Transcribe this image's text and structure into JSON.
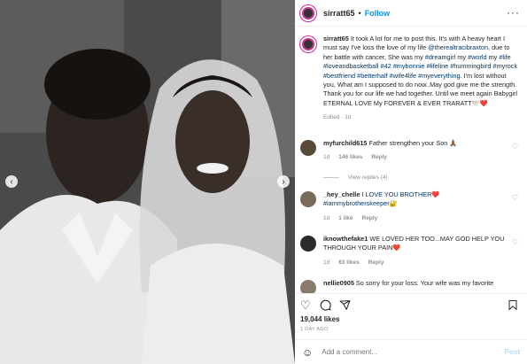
{
  "post": {
    "username": "sirratt65",
    "follow_label": "Follow",
    "more_icon": "more-horizontal-icon"
  },
  "caption": {
    "username": "sirratt65",
    "segments": [
      {
        "text": " It took A lot for me to post this. It's with A heavy heart I must say I've loss the love of my life ",
        "link": false
      },
      {
        "text": "@therealtracibraxton",
        "link": true
      },
      {
        "text": ", due to her battle with cancer, She was my ",
        "link": false
      },
      {
        "text": "#dreamgirl",
        "link": true
      },
      {
        "text": " my ",
        "link": false
      },
      {
        "text": "#world",
        "link": true
      },
      {
        "text": " my ",
        "link": false
      },
      {
        "text": "#life",
        "link": true
      },
      {
        "text": " ",
        "link": false
      },
      {
        "text": "#loveandbasketball",
        "link": true
      },
      {
        "text": " ",
        "link": false
      },
      {
        "text": "#42",
        "link": true
      },
      {
        "text": " ",
        "link": false
      },
      {
        "text": "#mybonnie",
        "link": true
      },
      {
        "text": " ",
        "link": false
      },
      {
        "text": "#lifeline",
        "link": true
      },
      {
        "text": " ",
        "link": false
      },
      {
        "text": "#hummingbird",
        "link": true
      },
      {
        "text": " ",
        "link": false
      },
      {
        "text": "#myrock",
        "link": true
      },
      {
        "text": " ",
        "link": false
      },
      {
        "text": "#bestfriend",
        "link": true
      },
      {
        "text": " ",
        "link": false
      },
      {
        "text": "#betterhalf",
        "link": true
      },
      {
        "text": " ",
        "link": false
      },
      {
        "text": "#wife4life",
        "link": true
      },
      {
        "text": " ",
        "link": false
      },
      {
        "text": "#myeverything",
        "link": true
      },
      {
        "text": ". I'm lost without you, What am I supposed to do now..May god give me the strength. Thank you for our life we had together. Until we meet again Babygirl ETERNAL LOVE My FOREVER & EVER TRARATT🕊️❤️",
        "link": false
      }
    ],
    "meta": "Edited · 1d"
  },
  "comments": [
    {
      "username": "myfurchild615",
      "text": " Father strengthen your Son 🙏🏾",
      "age": "1d",
      "likes": "146 likes",
      "reply": "Reply",
      "avatar_color": "#5a4a3a"
    },
    {
      "username": "_hey_chelle",
      "text": " I LOVE YOU BROTHER❤️ #iammybrotherskeeper🔐",
      "age": "1d",
      "likes": "1 like",
      "reply": "Reply",
      "avatar_color": "#7a6a5a"
    },
    {
      "username": "iknowthefake1",
      "text": " WE LOVED HER TOO...MAY GOD HELP YOU THROUGH YOUR PAIN❤️",
      "age": "1d",
      "likes": "63 likes",
      "reply": "Reply",
      "avatar_color": "#2a2a2a"
    },
    {
      "username": "nellie0905",
      "text": " So sorry for your loss. Your wife was my favorite",
      "age": "",
      "likes": "",
      "reply": "",
      "avatar_color": "#8a7a6a"
    }
  ],
  "view_replies": "View replies (4)",
  "likes": "19,044 likes",
  "time_ago": "1 DAY AGO",
  "add_comment": {
    "placeholder": "Add a comment...",
    "post_label": "Post"
  },
  "icons": {
    "like": "heart-icon",
    "comment": "comment-icon",
    "share": "share-icon",
    "save": "bookmark-icon",
    "emoji": "emoji-icon",
    "prev": "chevron-left-icon",
    "next": "chevron-right-icon"
  },
  "colors": {
    "accent": "#0095f6",
    "link": "#00376b",
    "muted": "#8e8e8e",
    "post_disabled": "#b2dffc"
  }
}
